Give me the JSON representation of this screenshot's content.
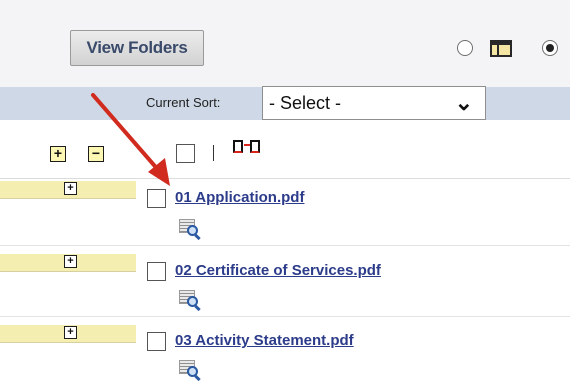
{
  "header": {
    "view_folders_label": "View Folders",
    "radio_left_selected": false,
    "radio_right_selected": true
  },
  "sort": {
    "label": "Current Sort:",
    "selected": "- Select -"
  },
  "toolbar": {
    "expand_symbol": "+",
    "collapse_symbol": "−"
  },
  "files": [
    {
      "name": "01 Application.pdf"
    },
    {
      "name": "02 Certificate of Services.pdf"
    },
    {
      "name": "03 Activity Statement.pdf"
    }
  ],
  "colors": {
    "link": "#2c3c8a",
    "sort_bar": "#cfd8e6",
    "expand_highlight": "#f4efb0",
    "annotation_arrow": "#d12a1e"
  }
}
